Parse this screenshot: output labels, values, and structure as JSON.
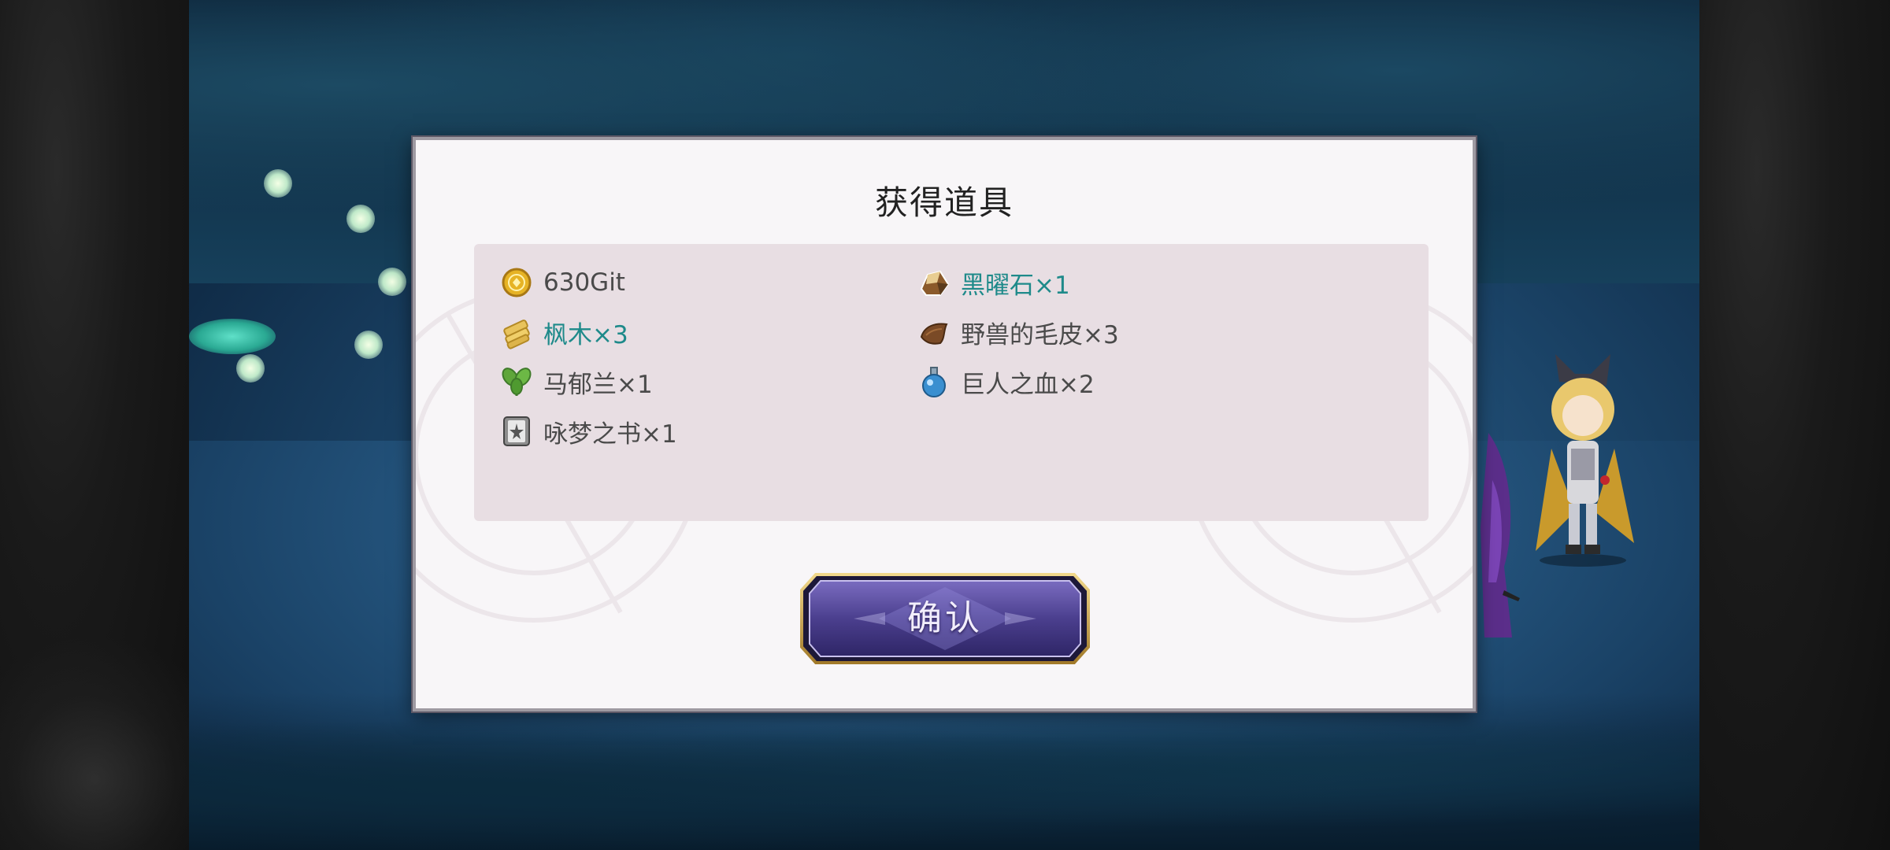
{
  "dialog": {
    "title": "获得道具",
    "confirm_label": "确认"
  },
  "items": [
    {
      "icon": "gold-coin-icon",
      "label": "630Git",
      "rare": false
    },
    {
      "icon": "obsidian-stone-icon",
      "label": "黑曜石×1",
      "rare": true
    },
    {
      "icon": "maple-wood-icon",
      "label": "枫木×3",
      "rare": true
    },
    {
      "icon": "beast-pelt-icon",
      "label": "野兽的毛皮×3",
      "rare": false
    },
    {
      "icon": "marjoram-herb-icon",
      "label": "马郁兰×1",
      "rare": false
    },
    {
      "icon": "potion-flask-icon",
      "label": "巨人之血×2",
      "rare": false
    },
    {
      "icon": "dream-book-icon",
      "label": "咏梦之书×1",
      "rare": false
    }
  ],
  "colors": {
    "rare_text": "#1e8a8a",
    "normal_text": "#4a4a4a",
    "panel_bg": "#e8dee3",
    "button_purple": "#4b3f8e",
    "button_gold": "#c9a24a"
  }
}
